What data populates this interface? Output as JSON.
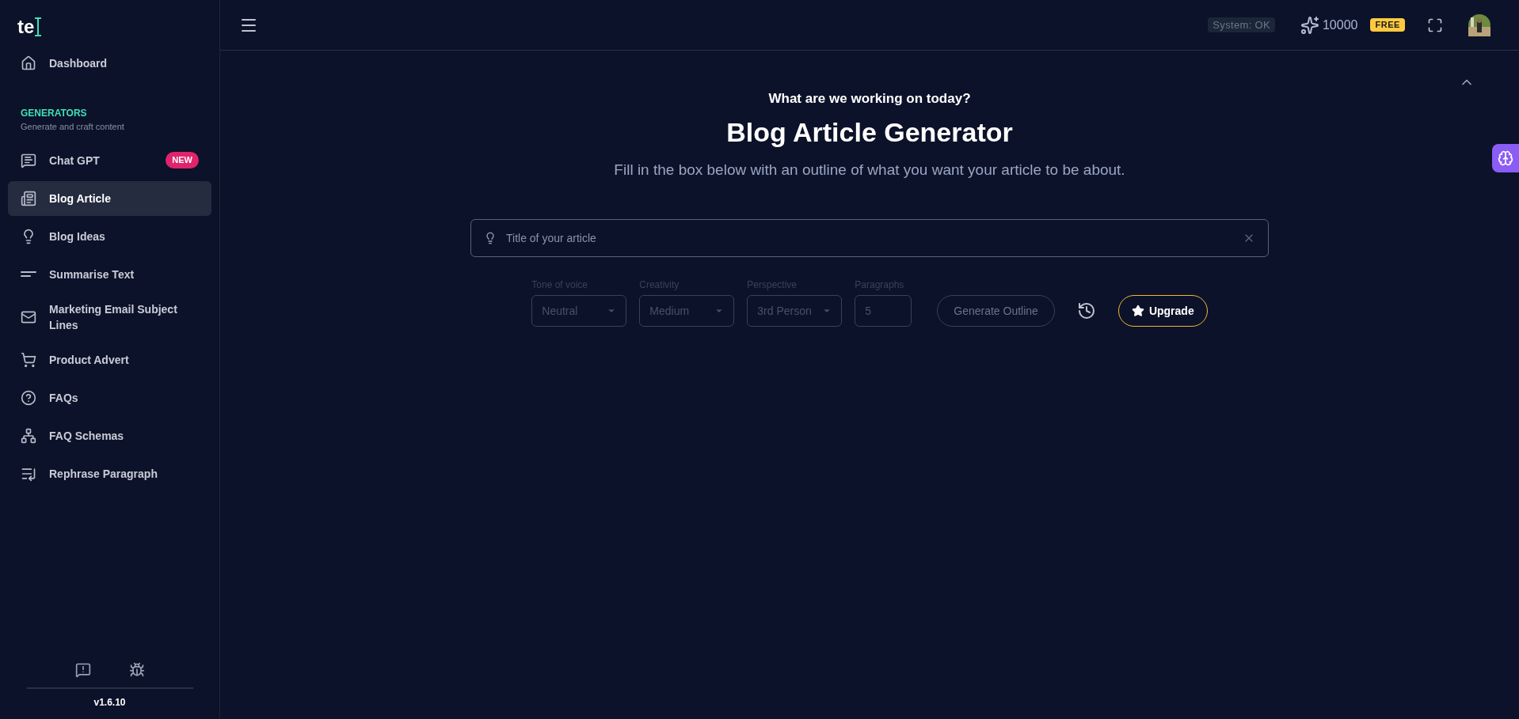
{
  "logo": {
    "text": "te"
  },
  "sidebar": {
    "top_item": {
      "label": "Dashboard",
      "selected": false
    },
    "section": {
      "title": "GENERATORS",
      "subtitle": "Generate and craft content"
    },
    "items": [
      {
        "label": "Chat GPT",
        "selected": false,
        "badge": "NEW"
      },
      {
        "label": "Blog Article",
        "selected": true
      },
      {
        "label": "Blog Ideas",
        "selected": false
      },
      {
        "label": "Summarise Text",
        "selected": false
      },
      {
        "label": "Marketing Email Subject Lines",
        "selected": false
      },
      {
        "label": "Product Advert",
        "selected": false
      },
      {
        "label": "FAQs",
        "selected": false
      },
      {
        "label": "FAQ Schemas",
        "selected": false
      },
      {
        "label": "Rephrase Paragraph",
        "selected": false
      }
    ],
    "version": "v1.6.10"
  },
  "header": {
    "status": "System: OK",
    "credits": "10000",
    "plan": "FREE"
  },
  "main": {
    "kicker": "What are we working on today?",
    "title": "Blog Article Generator",
    "description": "Fill in the box below with an outline of what you want your article to be about.",
    "title_field": {
      "placeholder": "Title of your article"
    },
    "options": [
      {
        "kind": "select",
        "label": "Tone of voice",
        "value": "Neutral",
        "disabled": true
      },
      {
        "kind": "select",
        "label": "Creativity",
        "value": "Medium",
        "disabled": true
      },
      {
        "kind": "select",
        "label": "Perspective",
        "value": "3rd Person",
        "disabled": true
      },
      {
        "kind": "number",
        "label": "Paragraphs",
        "value": "5",
        "disabled": true
      }
    ],
    "generate_button": {
      "label": "Generate Outline",
      "disabled": true
    },
    "upgrade_button": {
      "label": "Upgrade"
    }
  }
}
